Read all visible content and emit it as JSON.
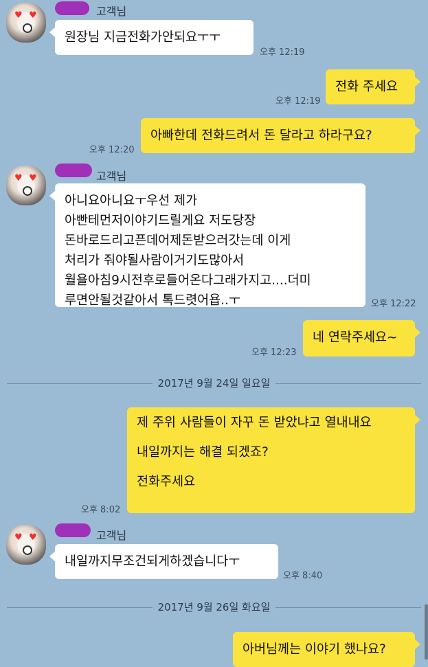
{
  "sender_suffix": "고객님",
  "messages": [
    {
      "type": "in",
      "text": "원장님 지금전화가안되요ㅜㅜ",
      "time": "오후 12:19"
    },
    {
      "type": "out",
      "text": "전화 주세요",
      "time": "오후 12:19"
    },
    {
      "type": "out",
      "text": "아빠한데 전화드려서 돈 달라고 하라구요?",
      "time": "오후 12:20"
    },
    {
      "type": "in",
      "lines": [
        "아니요아니요ㅜ우선 제가",
        "아빤테먼저이야기드릴게요 저도당장",
        "돈바로드리고픈데어제돈받으러갓는데 이게",
        "처리가 줘야될사람이거기도많아서",
        "월욜아침9시전후로들어온다그래가지고....더미",
        "루면안될것같아서 톡드렷어욥..ㅜ"
      ],
      "time": "오후 12:22"
    },
    {
      "type": "out",
      "text": "네 연락주세요~",
      "time": "오후 12:23"
    },
    {
      "type": "out",
      "lines": [
        "제 주위 사람들이 자꾸 돈 받았냐고 열내내요",
        "",
        "내일까지는 해결 되겠죠?",
        "",
        "전화주세요"
      ],
      "time": "오후 8:02"
    },
    {
      "type": "in",
      "text": "내일까지무조건되게하겠습니다ㅜ",
      "time": "오후 8:40"
    },
    {
      "type": "out",
      "text": "아버님께는 이야기 했나요?"
    }
  ],
  "dates": {
    "d1": "2017년 9월 24일 일요일",
    "d2": "2017년 9월 26일 화요일"
  }
}
